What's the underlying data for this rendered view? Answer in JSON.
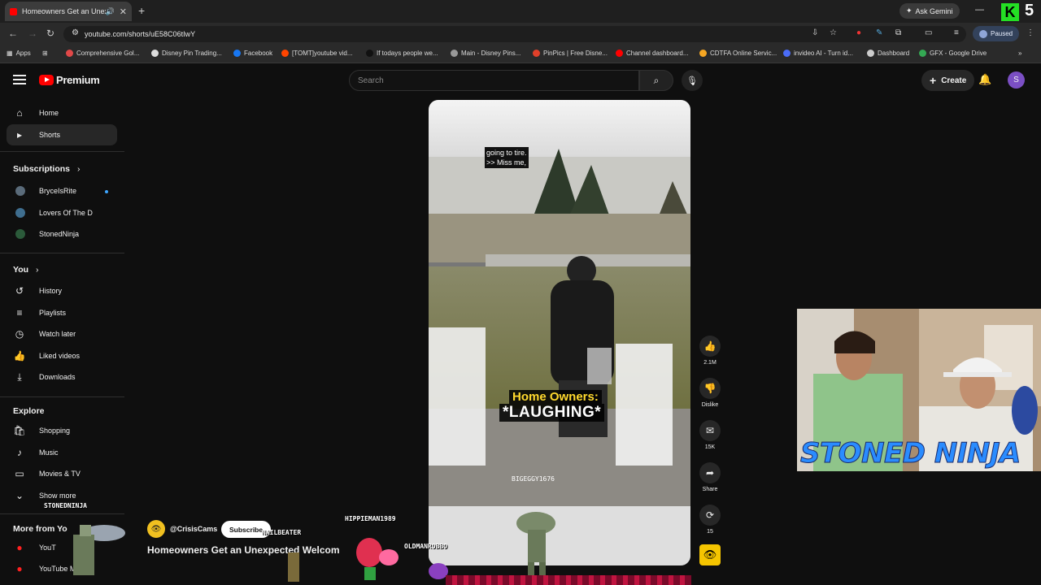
{
  "browser": {
    "tab_title": "Homeowners Get an Unexp",
    "new_tab": "+",
    "ask_gemini": "Ask Gemini",
    "url": "youtube.com/shorts/uE58C06tIwY",
    "profile_status": "Paused",
    "bookmarks": [
      {
        "label": "Apps",
        "color": "#888888"
      },
      {
        "label": "Comprehensive Gol...",
        "color": "#e04848"
      },
      {
        "label": "Disney Pin Trading...",
        "color": "#dddddd"
      },
      {
        "label": "Facebook",
        "color": "#1877f2"
      },
      {
        "label": "[TOMT]youtube vid...",
        "color": "#ff4500"
      },
      {
        "label": "If todays people we...",
        "color": "#111111"
      },
      {
        "label": "Main - Disney Pins...",
        "color": "#999999"
      },
      {
        "label": "PinPics | Free Disne...",
        "color": "#e0402a"
      },
      {
        "label": "Channel dashboard...",
        "color": "#ff0000"
      },
      {
        "label": "CDTFA Online Servic...",
        "color": "#f5a623"
      },
      {
        "label": "invideo AI - Turn id...",
        "color": "#4a6cf7"
      },
      {
        "label": "Dashboard",
        "color": "#cccccc"
      },
      {
        "label": "GFX - Google Drive",
        "color": "#34a853"
      }
    ]
  },
  "header": {
    "logo_text": "Premium",
    "search_placeholder": "Search",
    "create_label": "Create",
    "avatar_letter": "S"
  },
  "sidebar": {
    "main": [
      {
        "label": "Home",
        "icon": "home-icon",
        "glyph": "⌂"
      },
      {
        "label": "Shorts",
        "icon": "shorts-icon",
        "glyph": "▸"
      }
    ],
    "subscriptions_title": "Subscriptions",
    "subscriptions": [
      {
        "label": "BryceIsRite",
        "color": "#5a6b7a"
      },
      {
        "label": "Lovers Of The D",
        "color": "#3f6e8f"
      },
      {
        "label": "StonedNinja",
        "color": "#2b5a3a"
      }
    ],
    "you_title": "You",
    "you_items": [
      {
        "label": "History",
        "icon": "history-icon",
        "glyph": "↺"
      },
      {
        "label": "Playlists",
        "icon": "playlists-icon",
        "glyph": "≡"
      },
      {
        "label": "Watch later",
        "icon": "watch-later-icon",
        "glyph": "◷"
      },
      {
        "label": "Liked videos",
        "icon": "thumbs-up-icon",
        "glyph": "👍"
      },
      {
        "label": "Downloads",
        "icon": "download-icon",
        "glyph": "⤓"
      }
    ],
    "explore_title": "Explore",
    "explore_items": [
      {
        "label": "Shopping",
        "icon": "shopping-icon",
        "glyph": "🛍"
      },
      {
        "label": "Music",
        "icon": "music-icon",
        "glyph": "♪"
      },
      {
        "label": "Movies & TV",
        "icon": "movies-icon",
        "glyph": "▭"
      },
      {
        "label": "Show more",
        "icon": "chevron-down-icon",
        "glyph": "⌄"
      }
    ],
    "more_title": "More from Yo",
    "more_items": [
      {
        "label": "YouT",
        "icon": "youtube-premium-icon"
      },
      {
        "label": "YouTube M",
        "icon": "youtube-music-icon"
      }
    ]
  },
  "video": {
    "caption_line1": "going to tire.",
    "caption_line2": ">> Miss me,",
    "overlay_line1": "Home Owners:",
    "overlay_line2": "*LAUGHING*",
    "watermark": "BIGEGGY1676",
    "channel": "@CrisisCams",
    "subscribe": "Subscribe",
    "title": "Homeowners Get an Unexpected Welcom"
  },
  "actions": [
    {
      "name": "like-button",
      "icon": "thumbs-up-icon",
      "glyph": "👍",
      "label": "2.1M"
    },
    {
      "name": "dislike-button",
      "icon": "thumbs-down-icon",
      "glyph": "👎",
      "label": "Dislike"
    },
    {
      "name": "comments-button",
      "icon": "comment-icon",
      "glyph": "✉",
      "label": "15K"
    },
    {
      "name": "share-button",
      "icon": "share-icon",
      "glyph": "➦",
      "label": "Share"
    },
    {
      "name": "remix-button",
      "icon": "remix-icon",
      "glyph": "⟳",
      "label": "15"
    }
  ],
  "stream_overlay": {
    "brand": "STONED NINJA",
    "chat_names": [
      "STONEDNINJA",
      "HIPPIEMAN1989",
      "NAILBEATER",
      "OLDMANROBBO"
    ],
    "k_logo": "K",
    "number": "5"
  }
}
